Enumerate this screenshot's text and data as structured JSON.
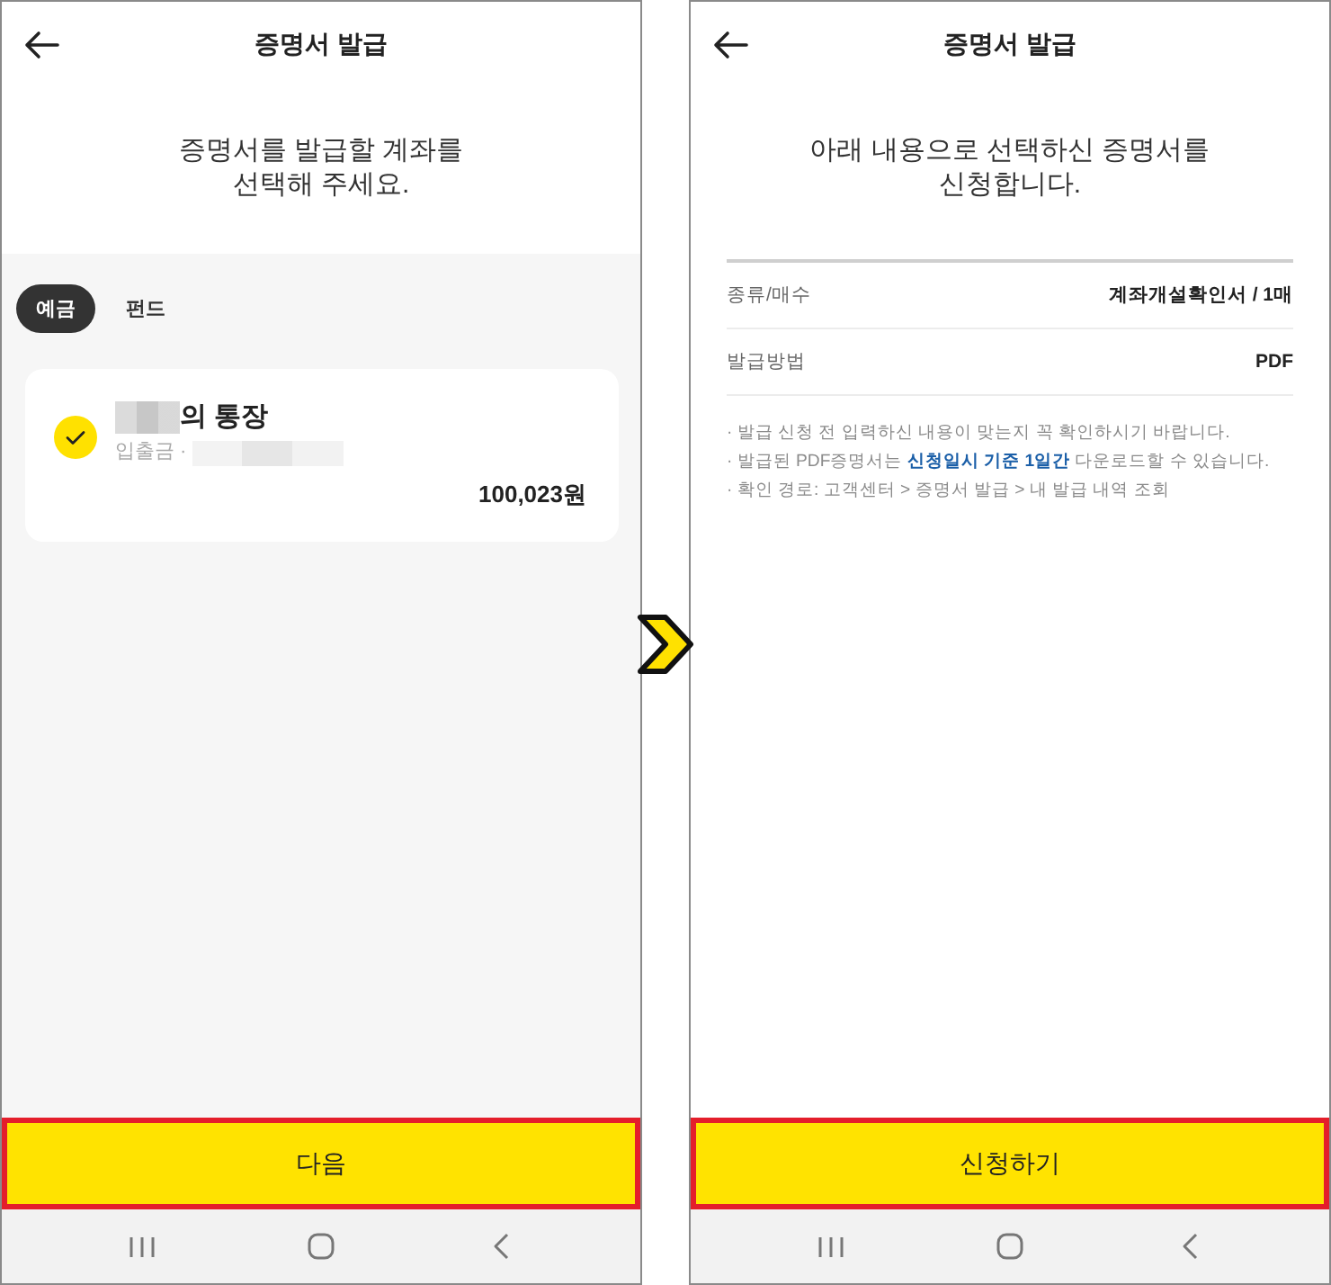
{
  "screens": [
    {
      "kind": "account_select",
      "title": "증명서 발급",
      "message": "증명서를 발급할 계좌를\n선택해 주세요.",
      "tabs": [
        {
          "label": "예금",
          "selected": true
        },
        {
          "label": "펀드",
          "selected": false
        }
      ],
      "accounts": [
        {
          "name": "의 통장",
          "type": "입출금 ·",
          "balance": "100,023원",
          "selected": true
        }
      ],
      "button": {
        "label": "다음",
        "highlighted": true
      }
    },
    {
      "kind": "confirm",
      "title": "증명서 발급",
      "message": "아래 내용으로 선택하신 증명서를\n신청합니다.",
      "details": [
        {
          "label": "종류/매수",
          "value": "계좌개설확인서 / 1매"
        },
        {
          "label": "발급방법",
          "value": "PDF"
        }
      ],
      "notes": [
        "· 발급 신청 전 입력하신 내용이 맞는지 꼭 확인하시기 바랍니다.",
        "· 발급된 PDF증명서는 **신청일시 기준 1일간** 다운로드할 수 있습니다.",
        "· 확인 경로: 고객센터 > 증명서 발급 > 내 발급 내역 조회"
      ],
      "button": {
        "label": "신청하기",
        "highlighted": true
      }
    }
  ]
}
